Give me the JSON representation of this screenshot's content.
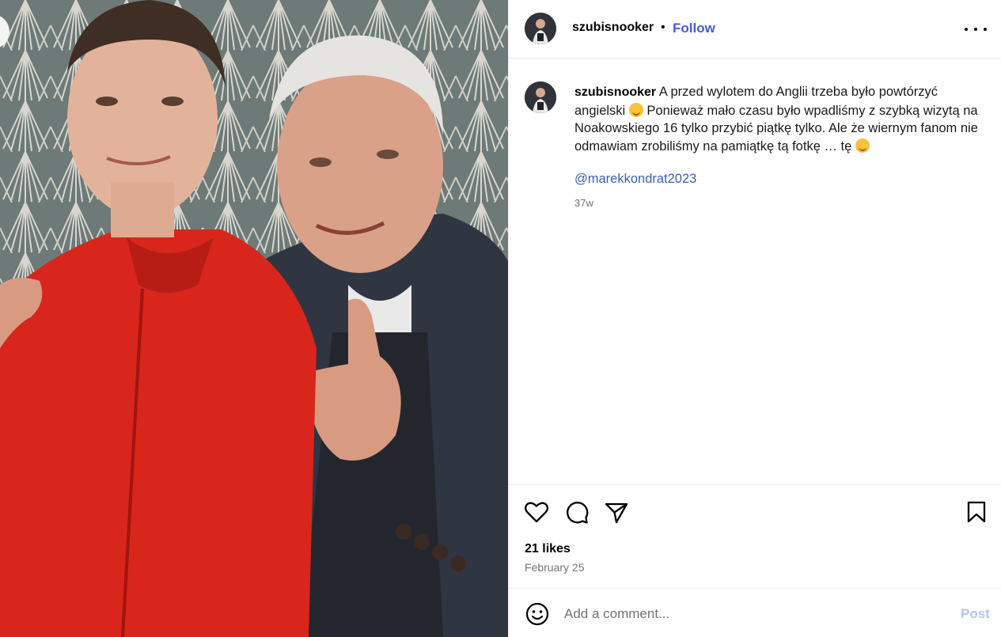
{
  "header": {
    "username": "szubisnooker",
    "separator": "•",
    "follow_label": "Follow",
    "more_icon": "more-horizontal-icon"
  },
  "caption": {
    "username": "szubisnooker",
    "text_part1": "A przed wylotem do Anglii trzeba było powtórzyć angielski",
    "text_part2": "Ponieważ mało czasu było wpadliśmy z szybką wizytą na Noakowskiego 16 tylko przybić piątkę tylko. Ale że wiernym fanom nie odmawiam zrobiliśmy na pamiątkę tą fotkę … tę",
    "mention": "@marekkondrat2023",
    "time": "37w"
  },
  "actions": {
    "like_icon": "heart-icon",
    "comment_icon": "comment-icon",
    "share_icon": "send-icon",
    "save_icon": "bookmark-icon",
    "likes": "21 likes",
    "date": "February 25"
  },
  "comment": {
    "emoji_icon": "smiley-icon",
    "placeholder": "Add a comment...",
    "post_label": "Post"
  },
  "colors": {
    "follow": "#4a5bd4",
    "mention": "#3a5fb3",
    "post_disabled": "#b2c8f7",
    "muted": "#737373"
  }
}
